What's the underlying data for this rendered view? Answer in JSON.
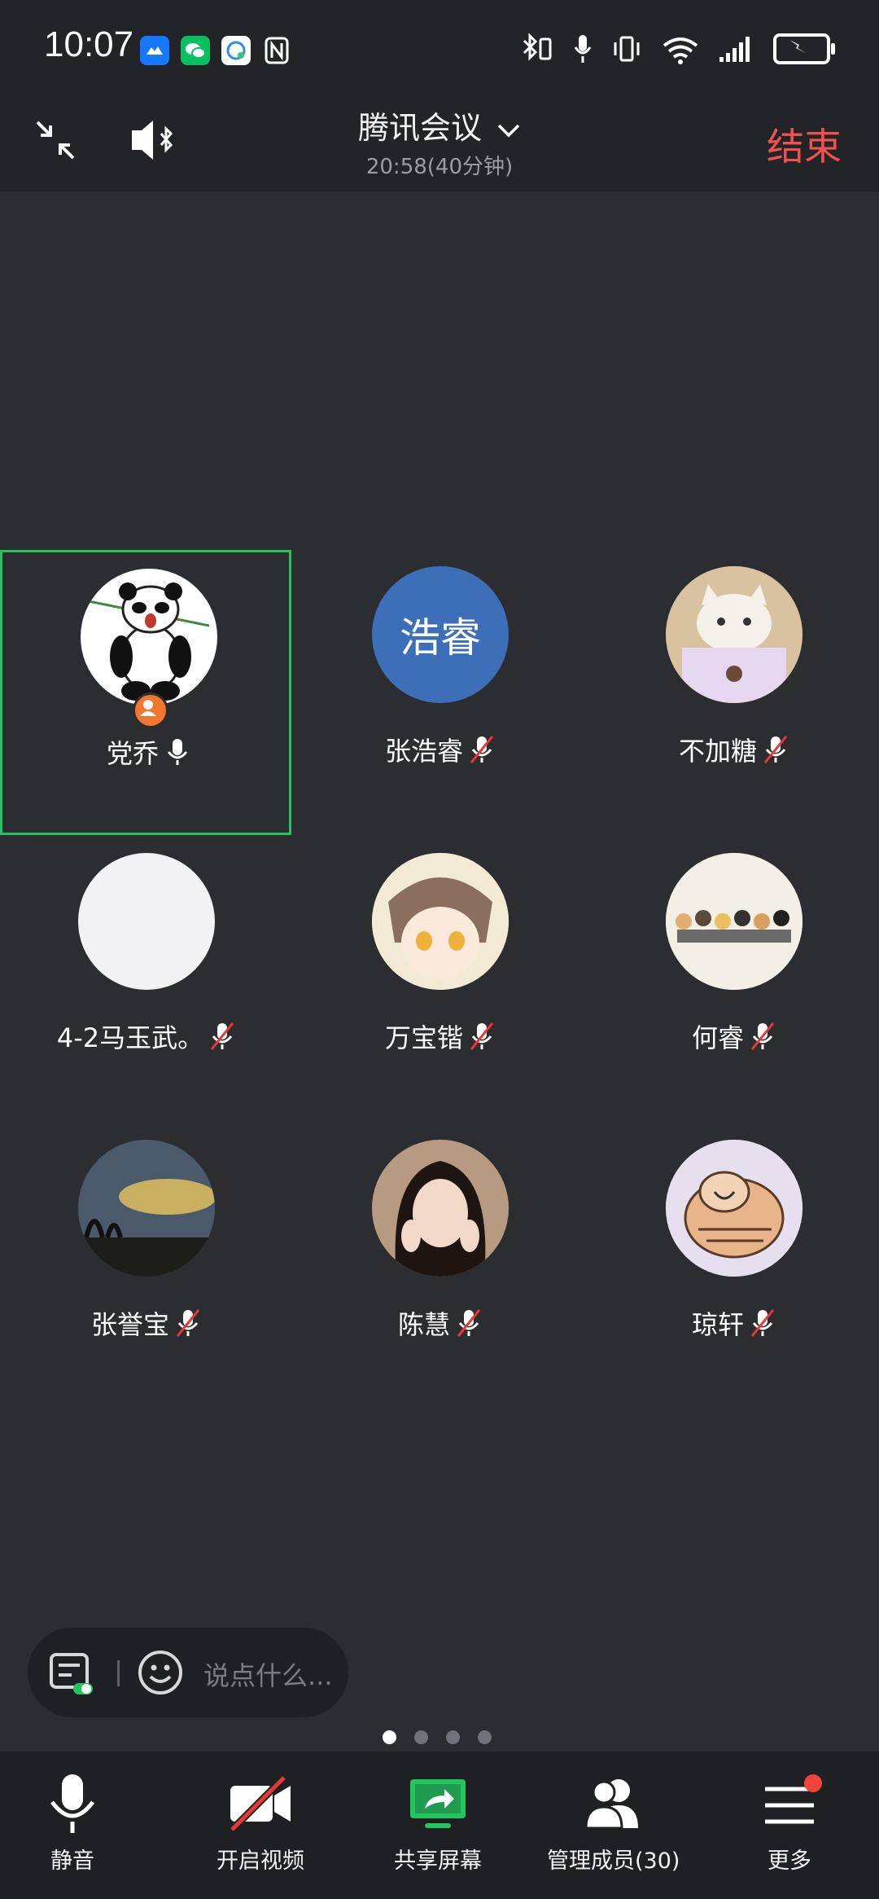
{
  "statusbar": {
    "time": "10:07"
  },
  "header": {
    "title": "腾讯会议",
    "subtitle": "20:58(40分钟)",
    "end_label": "结束"
  },
  "participants": [
    {
      "name": "党乔",
      "mic": "on",
      "avatar_text": ""
    },
    {
      "name": "张浩睿",
      "mic": "muted",
      "avatar_text": "浩睿"
    },
    {
      "name": "不加糖",
      "mic": "muted",
      "avatar_text": ""
    },
    {
      "name": "4-2马玉武。",
      "mic": "muted",
      "avatar_text": ""
    },
    {
      "name": "万宝锴",
      "mic": "muted",
      "avatar_text": ""
    },
    {
      "name": "何睿",
      "mic": "muted",
      "avatar_text": ""
    },
    {
      "name": "张誉宝",
      "mic": "muted",
      "avatar_text": ""
    },
    {
      "name": "陈慧",
      "mic": "muted",
      "avatar_text": ""
    },
    {
      "name": "琼轩",
      "mic": "muted",
      "avatar_text": ""
    }
  ],
  "chat": {
    "placeholder": "说点什么..."
  },
  "pagination": {
    "count": 4,
    "current": 1
  },
  "toolbar": {
    "mute": "静音",
    "video": "开启视频",
    "share": "共享屏幕",
    "members": "管理成员(30)",
    "more": "更多"
  },
  "colors": {
    "accent_green": "#22c55e",
    "end_red": "#f0534b",
    "avatar_blue": "#3d6fb8"
  }
}
